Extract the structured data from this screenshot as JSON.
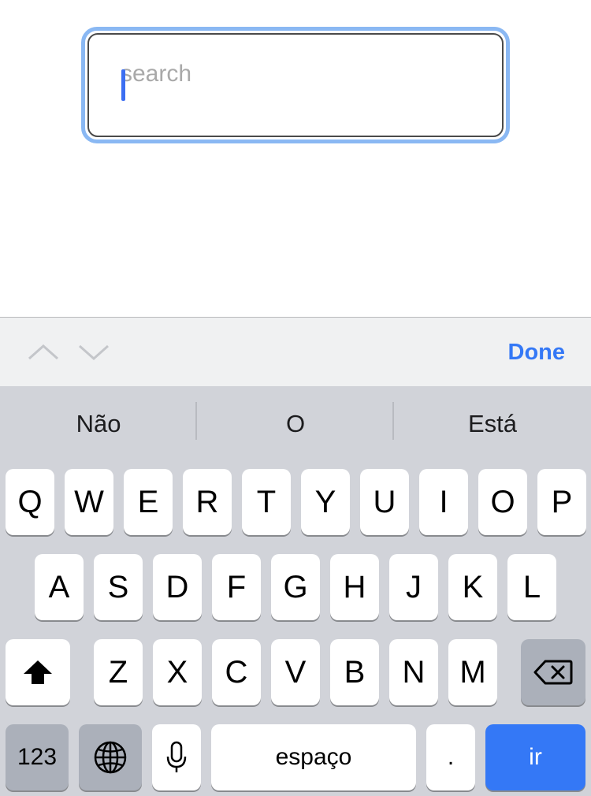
{
  "search": {
    "placeholder": "search",
    "value": ""
  },
  "toolbar": {
    "prev_icon": "chevron-up-icon",
    "next_icon": "chevron-down-icon",
    "done_label": "Done"
  },
  "predictions": [
    "Não",
    "O",
    "Está"
  ],
  "keyboard": {
    "row1": [
      "Q",
      "W",
      "E",
      "R",
      "T",
      "Y",
      "U",
      "I",
      "O",
      "P"
    ],
    "row2": [
      "A",
      "S",
      "D",
      "F",
      "G",
      "H",
      "J",
      "K",
      "L"
    ],
    "row3": [
      "Z",
      "X",
      "C",
      "V",
      "B",
      "N",
      "M"
    ],
    "shift_icon": "shift-icon",
    "backspace_icon": "backspace-icon",
    "numbers_label": "123",
    "globe_icon": "globe-icon",
    "mic_icon": "microphone-icon",
    "space_label": "espaço",
    "period_label": ".",
    "go_label": "ir"
  },
  "colors": {
    "accent": "#3478f6",
    "focus_ring": "#8ab8f3",
    "keyboard_bg": "#d1d3d9"
  }
}
